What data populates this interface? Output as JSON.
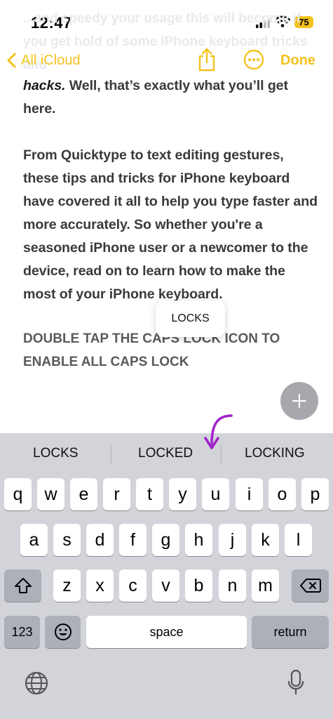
{
  "status": {
    "time": "12:47",
    "battery": "75"
  },
  "nav": {
    "back_label": "All iCloud",
    "done_label": "Done",
    "ghost_text": "...and speedy your usage this will become if you get hold of some iPhone keyboard tricks and"
  },
  "note": {
    "paragraph1_bold": "hacks.",
    "paragraph1_rest": " Well, that’s exactly what you’ll get here.",
    "paragraph2": "From Quicktype to text editing gestures, these tips and tricks for iPhone keyboard have covered it all to help you type faster and more accurately. So whether you're a seasoned iPhone user or a newcomer to the device, read on to learn how to make the most of your iPhone keyboard.",
    "caps_line": "DOUBLE TAP THE CAPS LOCK ICON TO ENABLE ALL CAPS LOCK"
  },
  "popup": {
    "text": "LOCKS"
  },
  "keyboard": {
    "suggestions": [
      "LOCKS",
      "LOCKED",
      "LOCKING"
    ],
    "row1": [
      "q",
      "w",
      "e",
      "r",
      "t",
      "y",
      "u",
      "i",
      "o",
      "p"
    ],
    "row2": [
      "a",
      "s",
      "d",
      "f",
      "g",
      "h",
      "j",
      "k",
      "l"
    ],
    "row3": [
      "z",
      "x",
      "c",
      "v",
      "b",
      "n",
      "m"
    ],
    "numbers_label": "123",
    "space_label": "space",
    "return_label": "return"
  },
  "colors": {
    "accent": "#f4c21c",
    "keyboard_bg": "#d2d4da",
    "arrow": "#a020c8"
  }
}
